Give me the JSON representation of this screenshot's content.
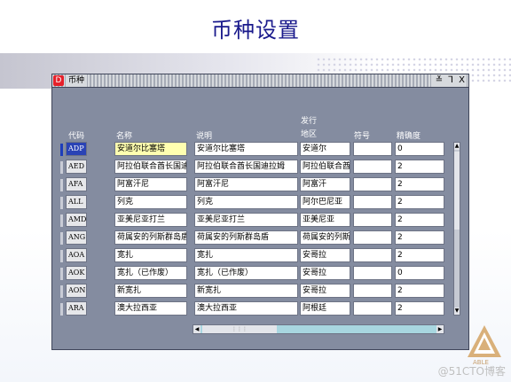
{
  "slide": {
    "title": "币种设置"
  },
  "window": {
    "icon_text": "D",
    "title": "币种",
    "controls": [
      "≚",
      "⅂",
      "X"
    ]
  },
  "columns": {
    "code": "代码",
    "name": "名称",
    "desc": "说明",
    "region_line1": "发行",
    "region_line2": "地区",
    "symbol": "符号",
    "precision": "精确度"
  },
  "rows": [
    {
      "code": "ADP",
      "name": "安道尔比塞塔",
      "desc": "安道尔比塞塔",
      "region": "安道尔",
      "symbol": "",
      "precision": "0"
    },
    {
      "code": "AED",
      "name": "阿拉伯联合酋长国迪拉",
      "desc": "阿拉伯联合酋长国迪拉姆",
      "region": "阿拉伯联合酋长",
      "symbol": "",
      "precision": "2"
    },
    {
      "code": "AFA",
      "name": "阿富汗尼",
      "desc": "阿富汗尼",
      "region": "阿富汗",
      "symbol": "",
      "precision": "2"
    },
    {
      "code": "ALL",
      "name": "列克",
      "desc": "列克",
      "region": "阿尔巴尼亚",
      "symbol": "",
      "precision": "2"
    },
    {
      "code": "AMD",
      "name": "亚美尼亚打兰",
      "desc": "亚美尼亚打兰",
      "region": "亚美尼亚",
      "symbol": "",
      "precision": "2"
    },
    {
      "code": "ANG",
      "name": "荷属安的列斯群岛盾",
      "desc": "荷属安的列斯群岛盾",
      "region": "荷属安的列斯群",
      "symbol": "",
      "precision": "2"
    },
    {
      "code": "AOA",
      "name": "宽扎",
      "desc": "宽扎",
      "region": "安哥拉",
      "symbol": "",
      "precision": "2"
    },
    {
      "code": "AOK",
      "name": "宽扎（已作废）",
      "desc": "宽扎（已作废）",
      "region": "安哥拉",
      "symbol": "",
      "precision": "0"
    },
    {
      "code": "AON",
      "name": "新宽扎",
      "desc": "新宽扎",
      "region": "安哥拉",
      "symbol": "",
      "precision": "2"
    },
    {
      "code": "ARA",
      "name": "澳大拉西亚",
      "desc": "澳大拉西亚",
      "region": "阿根廷",
      "symbol": "",
      "precision": "2"
    }
  ],
  "logo": {
    "text": "ABLE"
  },
  "watermark": "@51CTO博客"
}
